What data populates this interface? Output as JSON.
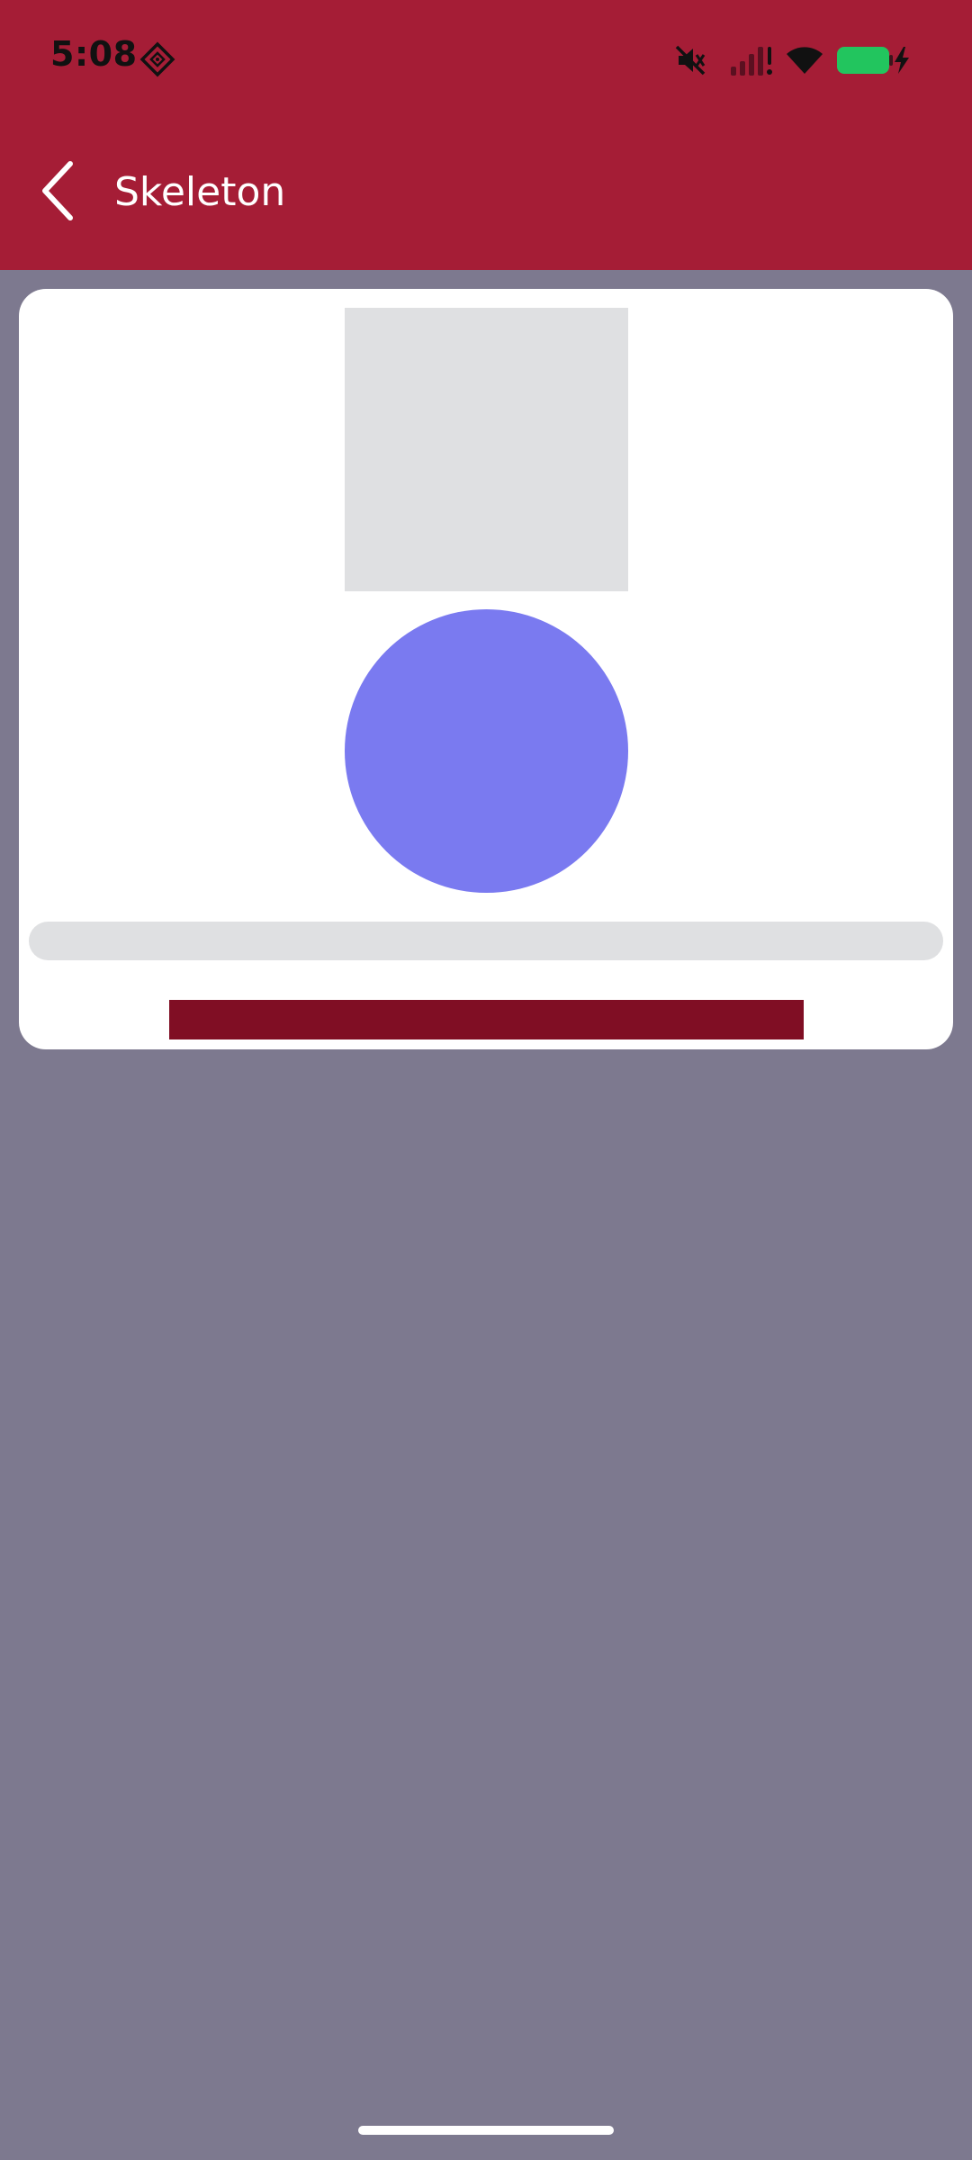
{
  "status_bar": {
    "time": "5:08",
    "icons": [
      "app-notification-icon",
      "mute-icon",
      "cellular-signal-icon",
      "wifi-icon",
      "battery-charging-icon"
    ]
  },
  "app_bar": {
    "title": "Skeleton",
    "back_icon": "chevron-left-icon"
  },
  "colors": {
    "app_bar": "#a51d36",
    "background": "#7d798f",
    "card": "#ffffff",
    "skeleton_placeholder": "#dfe0e2",
    "skeleton_circle": "#7a7af0",
    "skeleton_bar": "#800e24",
    "battery": "#22c55e"
  }
}
